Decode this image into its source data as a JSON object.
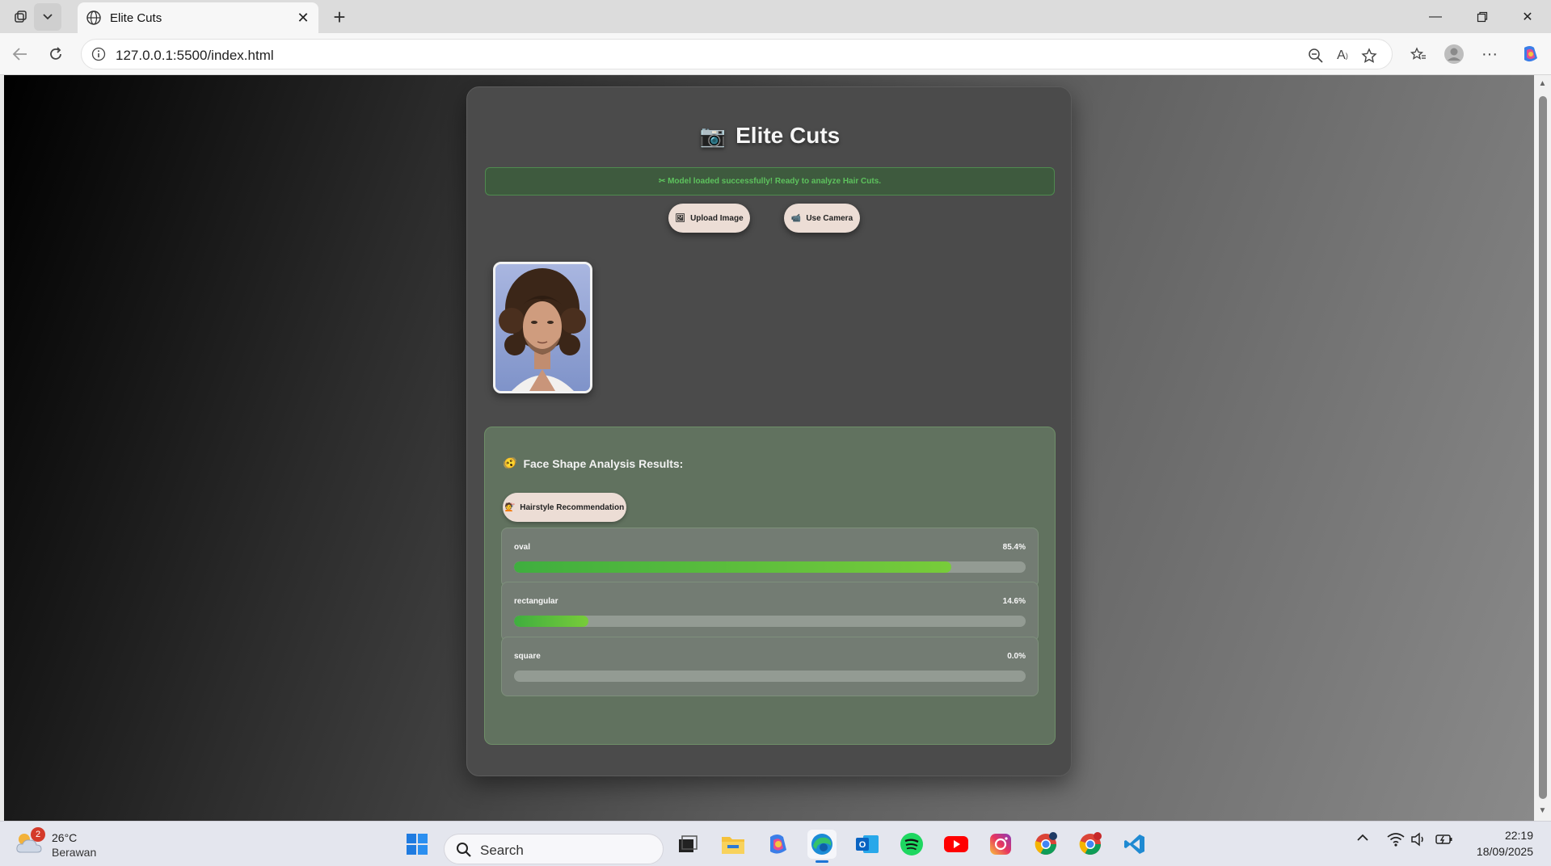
{
  "browser": {
    "tab_title": "Elite Cuts",
    "url": "127.0.0.1:5500/index.html"
  },
  "app": {
    "title": "Elite Cuts",
    "title_icon": "camera-icon",
    "status_message": "✂ Model loaded successfully! Ready to analyze Hair Cuts.",
    "upload_label": "Upload Image",
    "camera_label": "Use Camera",
    "results_title": "Face Shape Analysis Results:",
    "hairstyle_label": "Hairstyle Recommendation",
    "shapes": [
      {
        "name": "oval",
        "percent": "85.4%",
        "value": 85.4
      },
      {
        "name": "rectangular",
        "percent": "14.6%",
        "value": 14.6
      },
      {
        "name": "square",
        "percent": "0.0%",
        "value": 0.0
      }
    ],
    "colors": {
      "status_green": "#5dc25d",
      "bar_fill": "#78cc3a",
      "button_bg": "#ecddd5"
    }
  },
  "taskbar": {
    "weather_temp": "26°C",
    "weather_cond": "Berawan",
    "weather_badge": "2",
    "search_placeholder": "Search",
    "time": "22:19",
    "date": "18/09/2025"
  }
}
